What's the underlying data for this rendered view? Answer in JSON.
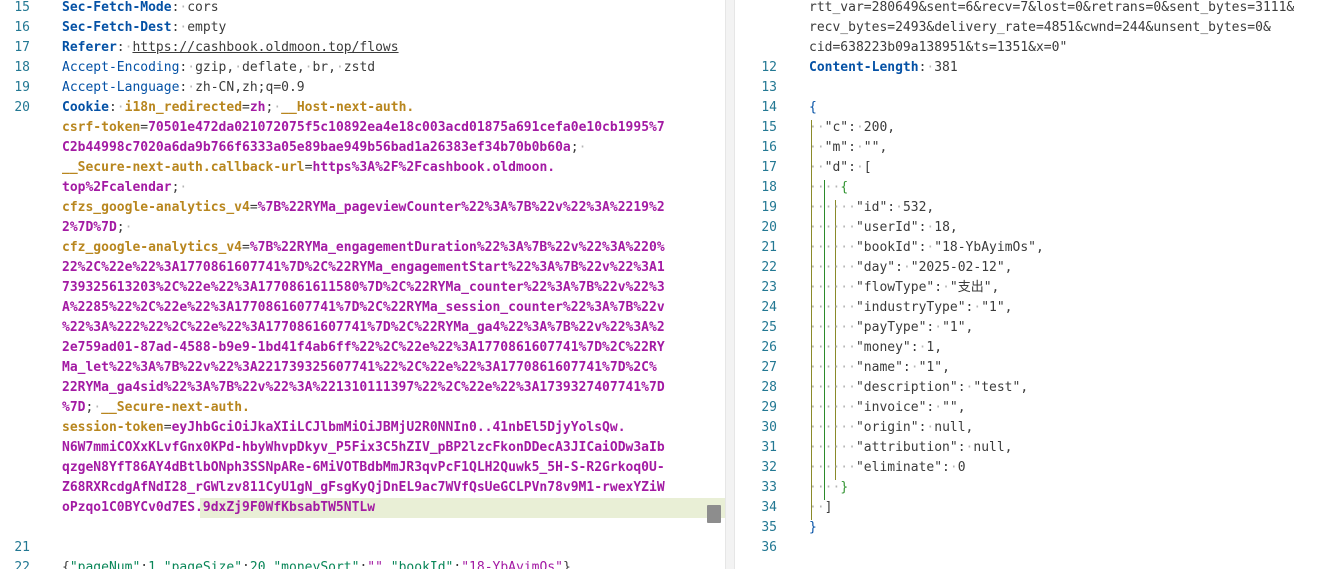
{
  "left": [
    {
      "n": "15",
      "segs": [
        [
          "k-bold",
          "Sec-Fetch-Mode"
        ],
        [
          "plain",
          ":"
        ],
        [
          "dot",
          "·"
        ],
        [
          "plain",
          "cors"
        ]
      ]
    },
    {
      "n": "16",
      "segs": [
        [
          "k-bold",
          "Sec-Fetch-Dest"
        ],
        [
          "plain",
          ":"
        ],
        [
          "dot",
          "·"
        ],
        [
          "plain",
          "empty"
        ]
      ]
    },
    {
      "n": "17",
      "segs": [
        [
          "k-bold",
          "Referer"
        ],
        [
          "plain",
          ":"
        ],
        [
          "dot",
          "·"
        ],
        [
          "url",
          "https://cashbook.oldmoon.top/flows"
        ]
      ]
    },
    {
      "n": "18",
      "segs": [
        [
          "k",
          "Accept-Encoding"
        ],
        [
          "plain",
          ":"
        ],
        [
          "dot",
          "·"
        ],
        [
          "plain",
          "gzip,"
        ],
        [
          "dot",
          "·"
        ],
        [
          "plain",
          "deflate,"
        ],
        [
          "dot",
          "·"
        ],
        [
          "plain",
          "br,"
        ],
        [
          "dot",
          "·"
        ],
        [
          "plain",
          "zstd"
        ]
      ]
    },
    {
      "n": "19",
      "segs": [
        [
          "k",
          "Accept-Language"
        ],
        [
          "plain",
          ":"
        ],
        [
          "dot",
          "·"
        ],
        [
          "plain",
          "zh-CN,zh;q=0.9"
        ]
      ]
    },
    {
      "n": "20",
      "segs": [
        [
          "k-bold",
          "Cookie"
        ],
        [
          "plain",
          ":"
        ],
        [
          "dot",
          "·"
        ],
        [
          "kc",
          "i18n_redirected"
        ],
        [
          "plain",
          "="
        ],
        [
          "vc",
          "zh"
        ],
        [
          "plain",
          ";"
        ],
        [
          "dot",
          "·"
        ],
        [
          "kc",
          "__Host-next-auth."
        ]
      ]
    },
    {
      "n": "",
      "segs": [
        [
          "kc",
          "csrf-token"
        ],
        [
          "plain",
          "="
        ],
        [
          "vc",
          "70501e472da021072075f5c10892ea4e18c003acd01875a691cefa0e10cb1995%7"
        ]
      ]
    },
    {
      "n": "",
      "segs": [
        [
          "vc",
          "C2b44998c7020a6da9b766f6333a05e89bae949b56bad1a26383ef34b70b0b60a"
        ],
        [
          "plain",
          ";"
        ],
        [
          "dot",
          "·"
        ]
      ]
    },
    {
      "n": "",
      "segs": [
        [
          "kc",
          "__Secure-next-auth.callback-url"
        ],
        [
          "plain",
          "="
        ],
        [
          "vc",
          "https%3A%2F%2Fcashbook.oldmoon."
        ]
      ]
    },
    {
      "n": "",
      "segs": [
        [
          "vc",
          "top%2Fcalendar"
        ],
        [
          "plain",
          ";"
        ],
        [
          "dot",
          "·"
        ]
      ]
    },
    {
      "n": "",
      "segs": [
        [
          "kc",
          "cfzs_google-analytics_v4"
        ],
        [
          "plain",
          "="
        ],
        [
          "vc",
          "%7B%22RYMa_pageviewCounter%22%3A%7B%22v%22%3A%2219%2"
        ]
      ]
    },
    {
      "n": "",
      "segs": [
        [
          "vc",
          "2%7D%7D"
        ],
        [
          "plain",
          ";"
        ],
        [
          "dot",
          "·"
        ]
      ]
    },
    {
      "n": "",
      "segs": [
        [
          "kc",
          "cfz_google-analytics_v4"
        ],
        [
          "plain",
          "="
        ],
        [
          "vc",
          "%7B%22RYMa_engagementDuration%22%3A%7B%22v%22%3A%220%"
        ]
      ]
    },
    {
      "n": "",
      "segs": [
        [
          "vc",
          "22%2C%22e%22%3A1770861607741%7D%2C%22RYMa_engagementStart%22%3A%7B%22v%22%3A1"
        ]
      ]
    },
    {
      "n": "",
      "segs": [
        [
          "vc",
          "739325613203%2C%22e%22%3A1770861611580%7D%2C%22RYMa_counter%22%3A%7B%22v%22%3"
        ]
      ]
    },
    {
      "n": "",
      "segs": [
        [
          "vc",
          "A%2285%22%2C%22e%22%3A1770861607741%7D%2C%22RYMa_session_counter%22%3A%7B%22v"
        ]
      ]
    },
    {
      "n": "",
      "segs": [
        [
          "vc",
          "%22%3A%222%22%2C%22e%22%3A1770861607741%7D%2C%22RYMa_ga4%22%3A%7B%22v%22%3A%2"
        ]
      ]
    },
    {
      "n": "",
      "segs": [
        [
          "vc",
          "2e759ad01-87ad-4588-b9e9-1bd41f4ab6ff%22%2C%22e%22%3A1770861607741%7D%2C%22RY"
        ]
      ]
    },
    {
      "n": "",
      "segs": [
        [
          "vc",
          "Ma_let%22%3A%7B%22v%22%3A221739325607741%22%2C%22e%22%3A1770861607741%7D%2C%"
        ]
      ]
    },
    {
      "n": "",
      "segs": [
        [
          "vc",
          "22RYMa_ga4sid%22%3A%7B%22v%22%3A%221310111397%22%2C%22e%22%3A1739327407741%7D"
        ]
      ]
    },
    {
      "n": "",
      "segs": [
        [
          "vc",
          "%7D"
        ],
        [
          "plain",
          ";"
        ],
        [
          "dot",
          "·"
        ],
        [
          "kc",
          "__Secure-next-auth."
        ]
      ]
    },
    {
      "n": "",
      "segs": [
        [
          "kc",
          "session-token"
        ],
        [
          "plain",
          "="
        ],
        [
          "vc",
          "eyJhbGciOiJkaXIiLCJlbmMiOiJBMjU2R0NNIn0..41nbEl5DjyYolsQw."
        ]
      ]
    },
    {
      "n": "",
      "segs": [
        [
          "vc",
          "N6W7mmiCOXxKLvfGnx0KPd-hbyWhvpDkyv_P5Fix3C5hZIV_pBP2lzcFkonDDecA3JICaiODw3aIb"
        ]
      ]
    },
    {
      "n": "",
      "segs": [
        [
          "vc",
          "qzgeN8YfT86AY4dBtlbONph3SSNpARe-6MiVOTBdbMmJR3qvPcF1QLH2Quwk5_5H-S-R2Grkoq0U-"
        ]
      ]
    },
    {
      "n": "",
      "segs": [
        [
          "vc",
          "Z68RXRcdgAfNdI28_rGWlzv811CyU1gN_gFsgKyQjDnEL9ac7WVfQsUeGCLPVn78v9M1-rwexYZiW"
        ]
      ]
    },
    {
      "n": "",
      "hl": true,
      "segs": [
        [
          "vc",
          "oPzqo1C0BYCv0d7ES.9dxZj9F0WfKbsabTW5NTLw"
        ]
      ]
    },
    {
      "n": "",
      "segs": []
    },
    {
      "n": "21",
      "segs": []
    },
    {
      "n": "22",
      "segs": [
        [
          "plain",
          "{"
        ],
        [
          "green",
          "\"pageNum\""
        ],
        [
          "plain",
          ":"
        ],
        [
          "num",
          "1"
        ],
        [
          "plain",
          ","
        ],
        [
          "green",
          "\"pageSize\""
        ],
        [
          "plain",
          ":"
        ],
        [
          "num",
          "20"
        ],
        [
          "plain",
          ","
        ],
        [
          "green",
          "\"moneySort\""
        ],
        [
          "plain",
          ":"
        ],
        [
          "purple",
          "\"\""
        ],
        [
          "plain",
          ","
        ],
        [
          "green",
          "\"bookId\""
        ],
        [
          "plain",
          ":"
        ],
        [
          "purple",
          "\"18-YbAyimOs\""
        ],
        [
          "plain",
          "}"
        ]
      ]
    }
  ],
  "right": [
    {
      "n": "",
      "segs": [
        [
          "plain",
          "rtt_var=280649&sent=6&recv=7&lost=0&retrans=0&sent_bytes=3111&"
        ]
      ]
    },
    {
      "n": "",
      "segs": [
        [
          "plain",
          "recv_bytes=2493&delivery_rate=4851&cwnd=244&unsent_bytes=0&"
        ]
      ]
    },
    {
      "n": "",
      "segs": [
        [
          "plain",
          "cid=638223b09a138951&ts=1351&x=0\""
        ]
      ]
    },
    {
      "n": "12",
      "segs": [
        [
          "k-bold",
          "Content-Length"
        ],
        [
          "plain",
          ":"
        ],
        [
          "dot",
          "·"
        ],
        [
          "plain",
          "381"
        ]
      ]
    },
    {
      "n": "13",
      "segs": []
    },
    {
      "n": "14",
      "segs": [
        [
          "brace-y",
          "{"
        ]
      ]
    },
    {
      "n": "15",
      "segs": [
        [
          "dot",
          "··"
        ],
        [
          "plain",
          "\"c\":"
        ],
        [
          "dot",
          "·"
        ],
        [
          "plain",
          "200,"
        ]
      ]
    },
    {
      "n": "16",
      "segs": [
        [
          "dot",
          "··"
        ],
        [
          "plain",
          "\"m\":"
        ],
        [
          "dot",
          "·"
        ],
        [
          "plain",
          "\"\","
        ]
      ]
    },
    {
      "n": "17",
      "segs": [
        [
          "dot",
          "··"
        ],
        [
          "plain",
          "\"d\":"
        ],
        [
          "dot",
          "·"
        ],
        [
          "plain",
          "["
        ]
      ]
    },
    {
      "n": "18",
      "segs": [
        [
          "dot",
          "····"
        ],
        [
          "brace-g",
          "{"
        ]
      ]
    },
    {
      "n": "19",
      "segs": [
        [
          "dot",
          "······"
        ],
        [
          "plain",
          "\"id\":"
        ],
        [
          "dot",
          "·"
        ],
        [
          "plain",
          "532,"
        ]
      ]
    },
    {
      "n": "20",
      "segs": [
        [
          "dot",
          "······"
        ],
        [
          "plain",
          "\"userId\":"
        ],
        [
          "dot",
          "·"
        ],
        [
          "plain",
          "18,"
        ]
      ]
    },
    {
      "n": "21",
      "segs": [
        [
          "dot",
          "······"
        ],
        [
          "plain",
          "\"bookId\":"
        ],
        [
          "dot",
          "·"
        ],
        [
          "plain",
          "\"18-YbAyimOs\","
        ]
      ]
    },
    {
      "n": "22",
      "segs": [
        [
          "dot",
          "······"
        ],
        [
          "plain",
          "\"day\":"
        ],
        [
          "dot",
          "·"
        ],
        [
          "plain",
          "\"2025-02-12\","
        ]
      ]
    },
    {
      "n": "23",
      "segs": [
        [
          "dot",
          "······"
        ],
        [
          "plain",
          "\"flowType\":"
        ],
        [
          "dot",
          "·"
        ],
        [
          "plain",
          "\"支出\","
        ]
      ]
    },
    {
      "n": "24",
      "segs": [
        [
          "dot",
          "······"
        ],
        [
          "plain",
          "\"industryType\":"
        ],
        [
          "dot",
          "·"
        ],
        [
          "plain",
          "\"1\","
        ]
      ]
    },
    {
      "n": "25",
      "segs": [
        [
          "dot",
          "······"
        ],
        [
          "plain",
          "\"payType\":"
        ],
        [
          "dot",
          "·"
        ],
        [
          "plain",
          "\"1\","
        ]
      ]
    },
    {
      "n": "26",
      "segs": [
        [
          "dot",
          "······"
        ],
        [
          "plain",
          "\"money\":"
        ],
        [
          "dot",
          "·"
        ],
        [
          "plain",
          "1,"
        ]
      ]
    },
    {
      "n": "27",
      "segs": [
        [
          "dot",
          "······"
        ],
        [
          "plain",
          "\"name\":"
        ],
        [
          "dot",
          "·"
        ],
        [
          "plain",
          "\"1\","
        ]
      ]
    },
    {
      "n": "28",
      "segs": [
        [
          "dot",
          "······"
        ],
        [
          "plain",
          "\"description\":"
        ],
        [
          "dot",
          "·"
        ],
        [
          "plain",
          "\"test\","
        ]
      ]
    },
    {
      "n": "29",
      "segs": [
        [
          "dot",
          "······"
        ],
        [
          "plain",
          "\"invoice\":"
        ],
        [
          "dot",
          "·"
        ],
        [
          "plain",
          "\"\","
        ]
      ]
    },
    {
      "n": "30",
      "segs": [
        [
          "dot",
          "······"
        ],
        [
          "plain",
          "\"origin\":"
        ],
        [
          "dot",
          "·"
        ],
        [
          "plain",
          "null,"
        ]
      ]
    },
    {
      "n": "31",
      "segs": [
        [
          "dot",
          "······"
        ],
        [
          "plain",
          "\"attribution\":"
        ],
        [
          "dot",
          "·"
        ],
        [
          "plain",
          "null,"
        ]
      ]
    },
    {
      "n": "32",
      "segs": [
        [
          "dot",
          "······"
        ],
        [
          "plain",
          "\"eliminate\":"
        ],
        [
          "dot",
          "·"
        ],
        [
          "plain",
          "0"
        ]
      ]
    },
    {
      "n": "33",
      "segs": [
        [
          "dot",
          "····"
        ],
        [
          "brace-g",
          "}"
        ]
      ]
    },
    {
      "n": "34",
      "segs": [
        [
          "dot",
          "··"
        ],
        [
          "plain",
          "]"
        ]
      ]
    },
    {
      "n": "35",
      "segs": [
        [
          "brace-y",
          "}"
        ]
      ]
    },
    {
      "n": "36",
      "segs": []
    }
  ]
}
